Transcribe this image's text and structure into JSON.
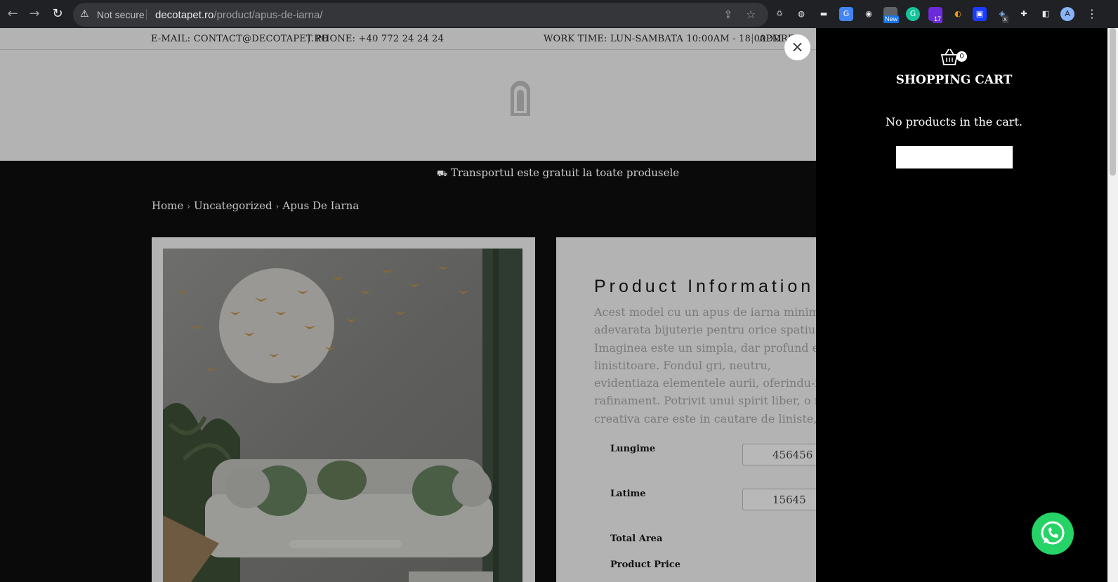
{
  "browser": {
    "security_label": "Not secure",
    "url_domain": "decotapet.ro",
    "url_path": "/product/apus-de-iarna/",
    "extensions": [
      {
        "name": "recycle-icon"
      },
      {
        "name": "globe-icon"
      },
      {
        "name": "cast-icon"
      },
      {
        "name": "google-translate-icon"
      },
      {
        "name": "camera-icon"
      },
      {
        "name": "new-extension-icon",
        "badge": "New"
      },
      {
        "name": "grammarly-icon",
        "label": "G"
      },
      {
        "name": "tab-counter-icon",
        "badge": "17"
      },
      {
        "name": "moon-icon"
      },
      {
        "name": "screen-record-icon"
      },
      {
        "name": "eye-x-icon",
        "badge": "x"
      },
      {
        "name": "extensions-puzzle-icon"
      },
      {
        "name": "side-panel-icon"
      }
    ],
    "profile_initial": "A"
  },
  "topbar": {
    "email": "E-MAIL: CONTACT@DECOTAPET.RO",
    "phone": "PHONE: +40 772 24 24 24",
    "worktime": "WORK TIME: LUN-SAMBATA 10:00AM - 18:00PM",
    "address": "ADDRE"
  },
  "promo": {
    "text": "Transportul este gratuit la toate produsele"
  },
  "breadcrumb": {
    "home": "Home",
    "category": "Uncategorized",
    "current": "Apus De Iarna"
  },
  "product": {
    "info_title": "Product Information",
    "description_lines": [
      "Acest model cu un apus de iarna minimal",
      "adevarata bijuterie pentru orice spatiu.",
      "Imaginea este un simpla, dar profund em",
      "linistitoare. Fondul gri, neutru,",
      "evidentiaza elementele aurii, oferindu-i",
      "rafinament. Potrivit unui spirit liber, o m",
      "creativa care este in cautare de liniste, de"
    ],
    "fields": {
      "lungime_label": "Lungime",
      "lungime_value": "456456",
      "latime_label": "Latime",
      "latime_value": "15645",
      "total_area_label": "Total Area",
      "product_price_label": "Product Price"
    }
  },
  "cart": {
    "count": "0",
    "title": "SHOPPING CART",
    "empty_message": "No products in the cart."
  },
  "colors": {
    "overlay_gray": "#b3b3b3",
    "page_dark": "#0a0a0a",
    "cart_bg": "#000000",
    "whatsapp_green": "#25d366"
  }
}
